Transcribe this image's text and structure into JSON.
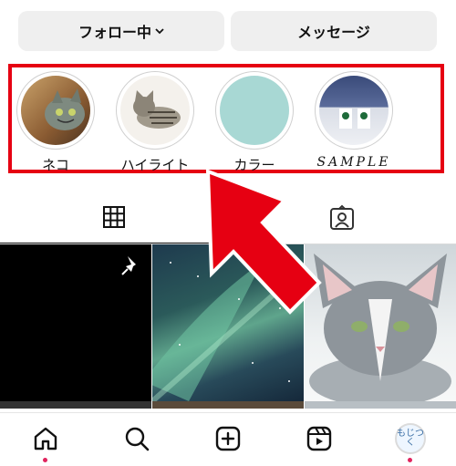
{
  "profile_actions": {
    "follow_label": "フォロー中",
    "message_label": "メッセージ"
  },
  "highlights": [
    {
      "label": "ネコ"
    },
    {
      "label": "ハイライト"
    },
    {
      "label": "カラー"
    },
    {
      "label": "SAMPLE"
    }
  ],
  "tabs": [
    {
      "name": "posts-grid",
      "icon": "grid-icon",
      "active": true
    },
    {
      "name": "tagged",
      "icon": "tagged-person-icon",
      "active": false
    }
  ],
  "grid_posts": [
    {
      "name": "pinned-post",
      "pinned": true
    },
    {
      "name": "aurora-post"
    },
    {
      "name": "cat-post"
    }
  ],
  "bottom_nav": [
    {
      "name": "home",
      "icon": "home-icon",
      "notification_dot": true
    },
    {
      "name": "search",
      "icon": "search-icon"
    },
    {
      "name": "create",
      "icon": "plus-square-icon"
    },
    {
      "name": "reels",
      "icon": "reels-icon"
    },
    {
      "name": "profile",
      "icon": "avatar-icon",
      "avatar_text": "もじつく",
      "notification_dot": true
    }
  ],
  "colors": {
    "highlight_border": "#e60012",
    "arrow": "#e60012",
    "notification_dot": "#e0245e"
  }
}
